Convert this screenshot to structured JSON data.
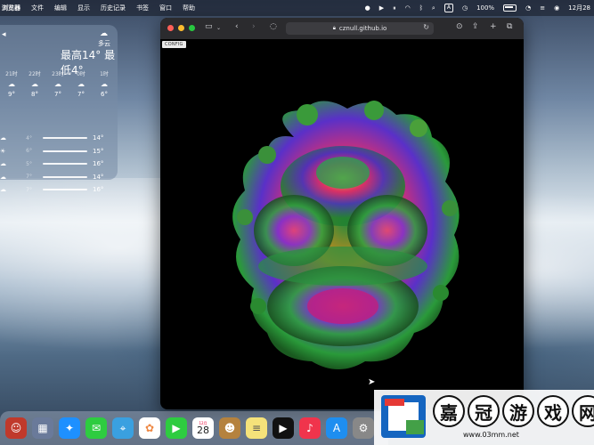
{
  "menubar": {
    "app_name": "浏览器",
    "items": [
      "文件",
      "编辑",
      "显示",
      "历史记录",
      "书签",
      "窗口",
      "帮助"
    ],
    "keyboard": "A",
    "battery": "100%",
    "datetime": "12月28"
  },
  "weather": {
    "location": "",
    "condition": "多云",
    "hilo": "最高14° 最低4°",
    "hourly": [
      {
        "time": "21时",
        "temp": "9°"
      },
      {
        "time": "22时",
        "temp": "8°"
      },
      {
        "time": "23时",
        "temp": "7°"
      },
      {
        "time": "0时",
        "temp": "7°"
      },
      {
        "time": "1时",
        "temp": "6°"
      }
    ],
    "daily": [
      {
        "low": "4°",
        "high": "14°"
      },
      {
        "low": "6°",
        "high": "15°"
      },
      {
        "low": "5°",
        "high": "16°"
      },
      {
        "low": "7°",
        "high": "14°"
      },
      {
        "low": "7°",
        "high": "16°"
      }
    ]
  },
  "browser": {
    "url": "cznull.github.io",
    "config_label": "CONFIG"
  },
  "dock": {
    "calendar_month": "12月",
    "calendar_day": "28"
  },
  "watermark": {
    "chars": [
      "嘉",
      "冠",
      "游",
      "戏",
      "网"
    ],
    "url": "www.03mm.net"
  },
  "colors": {
    "close": "#ff5f57",
    "minimize": "#febc2e",
    "maximize": "#28c840"
  }
}
